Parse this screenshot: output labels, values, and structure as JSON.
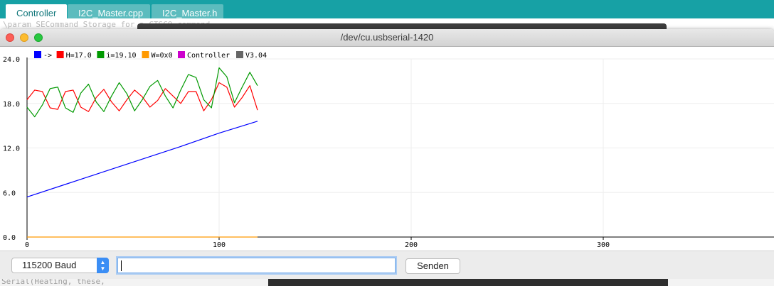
{
  "ide": {
    "tabs": [
      {
        "label": "Controller",
        "active": true
      },
      {
        "label": "I2C_Master.cpp",
        "active": false
      },
      {
        "label": "I2C_Master.h",
        "active": false
      }
    ],
    "editor_ghost_top": "\\param SECommand Storage for a CTSCO command",
    "editor_ghost_bottom": "Serial(Heating, these,"
  },
  "plotter": {
    "window_title": "/dev/cu.usbserial-1420",
    "legend": [
      {
        "label": "->",
        "color": "#0000ff"
      },
      {
        "label": "H=17.0",
        "color": "#ff0000"
      },
      {
        "label": "i=19.10",
        "color": "#009900"
      },
      {
        "label": "W=0x0",
        "color": "#ff9900"
      },
      {
        "label": "Controller",
        "color": "#cc00cc"
      },
      {
        "label": "V3.04",
        "color": "#666666"
      }
    ],
    "baud_value": "115200 Baud",
    "input_value": "",
    "send_label": "Senden"
  },
  "chart_data": {
    "type": "line",
    "ylim": [
      0,
      24
    ],
    "xlim": [
      0,
      400
    ],
    "grid": true,
    "yticks": [
      "0.0",
      "6.0",
      "12.0",
      "18.0",
      "24.0"
    ],
    "xticks": [
      "0",
      "100",
      "200",
      "300"
    ],
    "series": [
      {
        "name": "->",
        "color": "#0000ff",
        "x": [
          0,
          20,
          40,
          60,
          80,
          100,
          120
        ],
        "values": [
          5.4,
          7.1,
          8.8,
          10.5,
          12.2,
          14.0,
          15.6
        ]
      },
      {
        "name": "H=17.0",
        "color": "#ff0000",
        "x": [
          0,
          4,
          8,
          12,
          16,
          20,
          24,
          28,
          32,
          36,
          40,
          44,
          48,
          52,
          56,
          60,
          64,
          68,
          72,
          76,
          80,
          84,
          88,
          92,
          96,
          100,
          104,
          108,
          112,
          116,
          120
        ],
        "values": [
          18.5,
          19.8,
          19.6,
          17.4,
          17.2,
          19.6,
          19.8,
          17.5,
          16.9,
          18.8,
          19.9,
          18.2,
          17.0,
          18.5,
          19.8,
          18.9,
          17.5,
          18.4,
          20.0,
          19.0,
          18.0,
          19.6,
          19.6,
          17.0,
          18.5,
          20.8,
          20.2,
          17.5,
          18.8,
          20.4,
          17.1
        ]
      },
      {
        "name": "i=19.10",
        "color": "#009900",
        "x": [
          0,
          4,
          8,
          12,
          16,
          20,
          24,
          28,
          32,
          36,
          40,
          44,
          48,
          52,
          56,
          60,
          64,
          68,
          72,
          76,
          80,
          84,
          88,
          92,
          96,
          100,
          104,
          108,
          112,
          116,
          120
        ],
        "values": [
          17.5,
          16.2,
          17.8,
          20.0,
          20.2,
          17.4,
          16.8,
          19.4,
          20.6,
          18.2,
          16.9,
          19.0,
          20.8,
          19.3,
          17.0,
          18.5,
          20.3,
          21.1,
          19.0,
          17.4,
          19.8,
          21.9,
          21.5,
          18.5,
          17.4,
          22.8,
          21.6,
          18.1,
          20.2,
          22.2,
          20.4
        ]
      },
      {
        "name": "W=0x0",
        "color": "#ff9900",
        "x": [
          0,
          120
        ],
        "values": [
          0.0,
          0.0
        ]
      }
    ]
  }
}
